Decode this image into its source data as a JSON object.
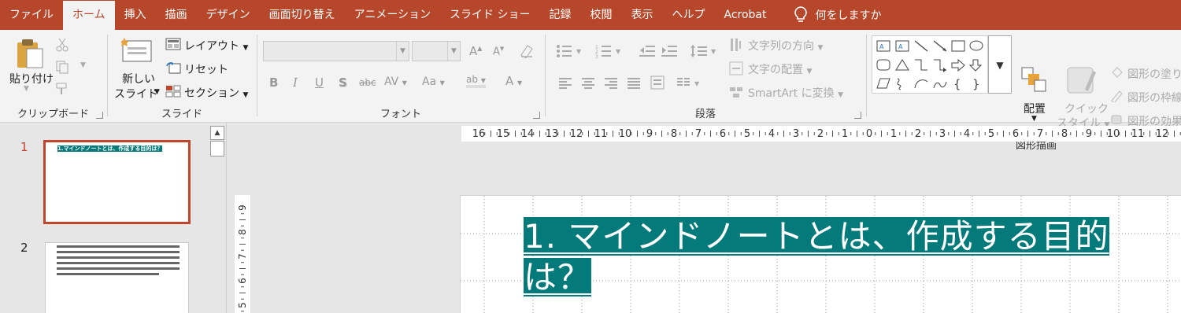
{
  "menu": {
    "tabs": [
      "ファイル",
      "ホーム",
      "挿入",
      "描画",
      "デザイン",
      "画面切り替え",
      "アニメーション",
      "スライド ショー",
      "記録",
      "校閲",
      "表示",
      "ヘルプ",
      "Acrobat"
    ],
    "active": "ホーム",
    "tell_me": "何をしますか"
  },
  "clipboard": {
    "paste": "貼り付け",
    "label": "クリップボード"
  },
  "slides_group": {
    "new_slide_1": "新しい",
    "new_slide_2": "スライド",
    "layout": "レイアウト",
    "reset": "リセット",
    "section": "セクション",
    "label": "スライド"
  },
  "font": {
    "label": "フォント",
    "font_name": "",
    "font_size": ""
  },
  "paragraph": {
    "text_direction": "文字列の方向",
    "align_text": "文字の配置",
    "smartart": "SmartArt に変換",
    "label": "段落"
  },
  "drawing": {
    "arrange": "配置",
    "quick_style_1": "クイック",
    "quick_style_2": "スタイル",
    "shape_fill": "図形の塗り",
    "shape_outline": "図形の枠線",
    "shape_effects": "図形の効果",
    "label": "図形描画"
  },
  "slides_panel": {
    "slide1_number": "1",
    "slide2_number": "2",
    "slide1_title": "1.マインドノートとは、作成する目的は？"
  },
  "hruler_labels": [
    "16",
    "15",
    "14",
    "13",
    "12",
    "11",
    "10",
    "9",
    "8",
    "7",
    "6",
    "5",
    "4",
    "3",
    "2",
    "1",
    "0",
    "1",
    "2",
    "3",
    "4",
    "5",
    "6",
    "7",
    "8",
    "9",
    "10",
    "11",
    "12"
  ],
  "vruler_labels": [
    "9",
    "8",
    "7",
    "6",
    "5"
  ],
  "slide": {
    "title": "1. マインドノートとは、作成する目的は？"
  },
  "colors": {
    "accent": "#b7472a",
    "title_highlight": "#047a7a"
  }
}
